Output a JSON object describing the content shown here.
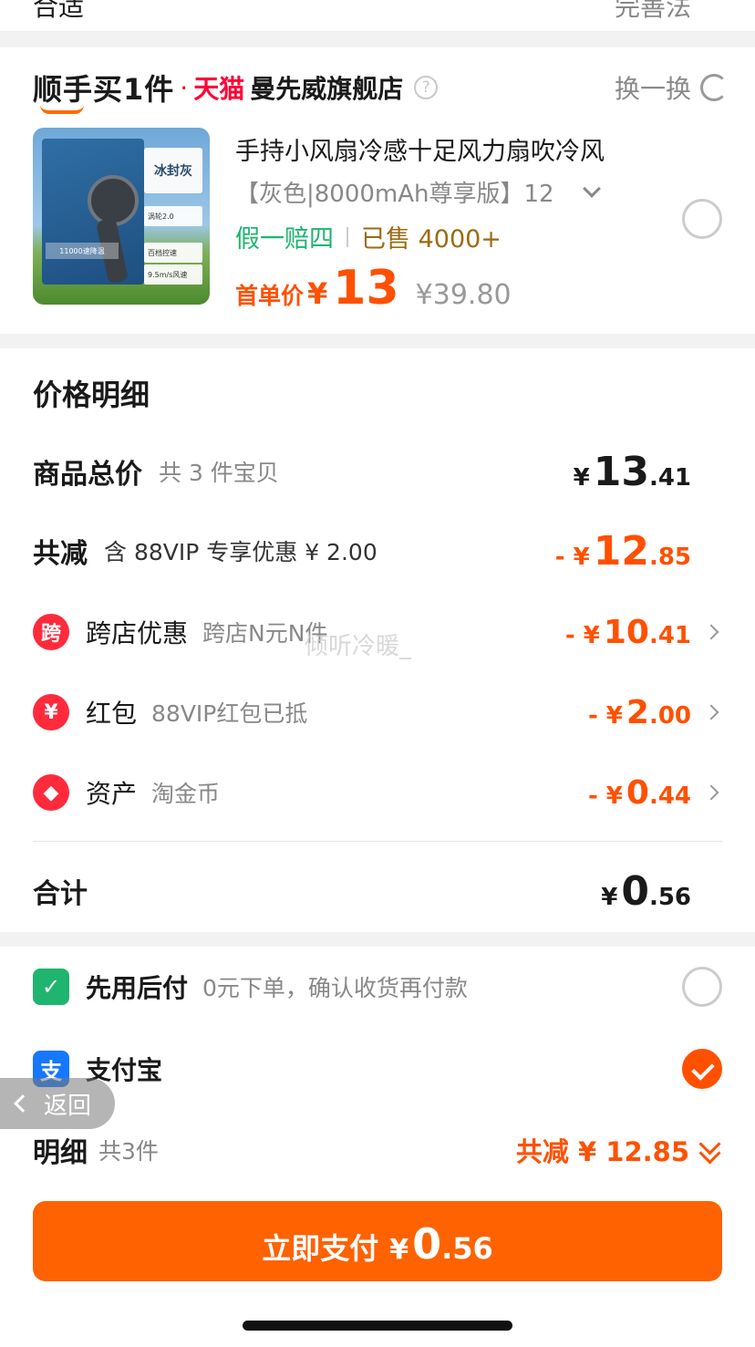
{
  "top_strip": {
    "left_text": "合适",
    "right_text": "完善法"
  },
  "buy_one": {
    "brand": "顺手买1件",
    "dot": "·",
    "tmall": "天猫",
    "store": "曼先威旗舰店",
    "help": "?",
    "swap_label": "换一换",
    "product": {
      "image_tag": "冰封灰",
      "image_features": [
        "涡轮2.0",
        "百档控速",
        "9.5m/s风速"
      ],
      "image_speed": "11000速降温",
      "title": "手持小风扇冷感十足风力扇吹冷风",
      "sku": "【灰色|8000mAh尊享版】12",
      "guarantee": "假一赔四",
      "sold": "已售 4000+",
      "price_label": "首单价",
      "currency": "¥",
      "price": "13",
      "original_price": "¥39.80"
    }
  },
  "price_detail": {
    "title": "价格明细",
    "goods_total": {
      "label": "商品总价",
      "sub": "共 3 件宝贝",
      "currency": "¥",
      "int": "13",
      "dec": ".41"
    },
    "total_reduction": {
      "label": "共减",
      "sub": "含 88VIP 专享优惠 ¥ 2.00",
      "prefix": "- ¥",
      "int": "12",
      "dec": ".85"
    },
    "discounts": [
      {
        "icon": "跨",
        "label": "跨店优惠",
        "sub": "跨店N元N件",
        "prefix": "- ¥",
        "int": "10",
        "dec": ".41",
        "color": "#ff2a3c"
      },
      {
        "icon": "¥",
        "label": "红包",
        "sub": "88VIP红包已抵",
        "prefix": "- ¥",
        "int": "2",
        "dec": ".00",
        "color": "#ff2a3c"
      },
      {
        "icon": "◆",
        "label": "资产",
        "sub": "淘金币",
        "prefix": "- ¥",
        "int": "0",
        "dec": ".44",
        "color": "#ff2a3c"
      }
    ],
    "watermark": "倾听冷暖_",
    "sum": {
      "label": "合计",
      "currency": "¥",
      "int": "0",
      "dec": ".56"
    }
  },
  "payment": {
    "methods": [
      {
        "icon": "✓",
        "label": "先用后付",
        "sub": "0元下单，确认收货再付款",
        "selected": false,
        "color": "#1fb56e"
      },
      {
        "icon": "支",
        "label": "支付宝",
        "sub": "",
        "selected": true,
        "color": "#1677ff"
      }
    ]
  },
  "back_button": "返回",
  "detail": {
    "label": "明细",
    "sub": "共3件",
    "total": "共减 ¥ 12.85"
  },
  "pay_button": {
    "label": "立即支付",
    "currency": "¥",
    "int": "0",
    "dec": ".56"
  },
  "colors": {
    "accent": "#ff5000",
    "button": "#ff6200",
    "tmall": "#ff0036",
    "guarantee": "#1eb56e"
  }
}
